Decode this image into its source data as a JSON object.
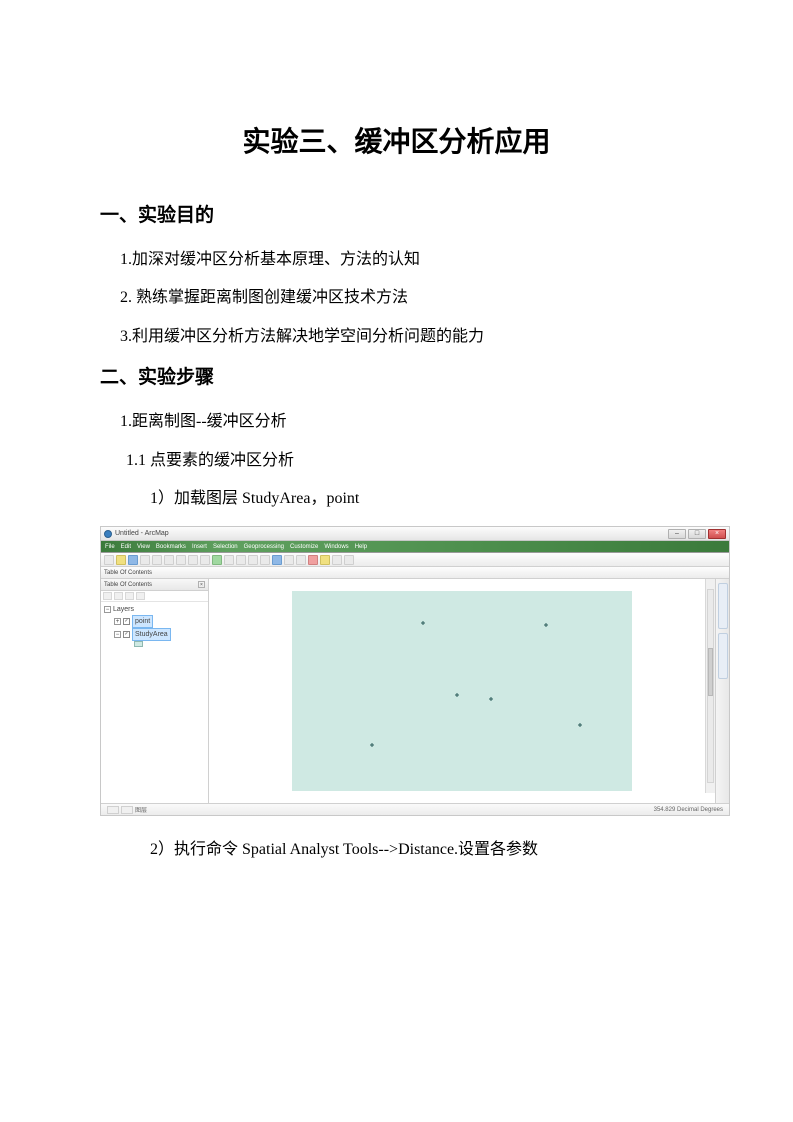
{
  "title": "实验三、缓冲区分析应用",
  "section1": {
    "heading": "一、实验目的",
    "items": [
      "1.加深对缓冲区分析基本原理、方法的认知",
      "2. 熟练掌握距离制图创建缓冲区技术方法",
      "3.利用缓冲区分析方法解决地学空间分析问题的能力"
    ]
  },
  "section2": {
    "heading": "二、实验步骤",
    "item1": "1.距离制图--缓冲区分析",
    "item1_1": "1.1 点要素的缓冲区分析",
    "step1_prefix": "1）加载图层 ",
    "step1_layers": "StudyArea，point",
    "step2_prefix": "2）执行命令 ",
    "step2_cmd": "Spatial Analyst Tools-->Distance.",
    "step2_suffix": "设置各参数"
  },
  "arcmap": {
    "window_title": "Untitled - ArcMap",
    "menus": [
      "File",
      "Edit",
      "View",
      "Bookmarks",
      "Insert",
      "Selection",
      "Geoprocessing",
      "Customize",
      "Windows",
      "Help"
    ],
    "toc_title": "Table Of Contents",
    "layers_root": "Layers",
    "layer_point": "point",
    "layer_studyarea": "StudyArea",
    "status_coords": "354.829 Decimal Degrees",
    "view_label": "图层"
  }
}
